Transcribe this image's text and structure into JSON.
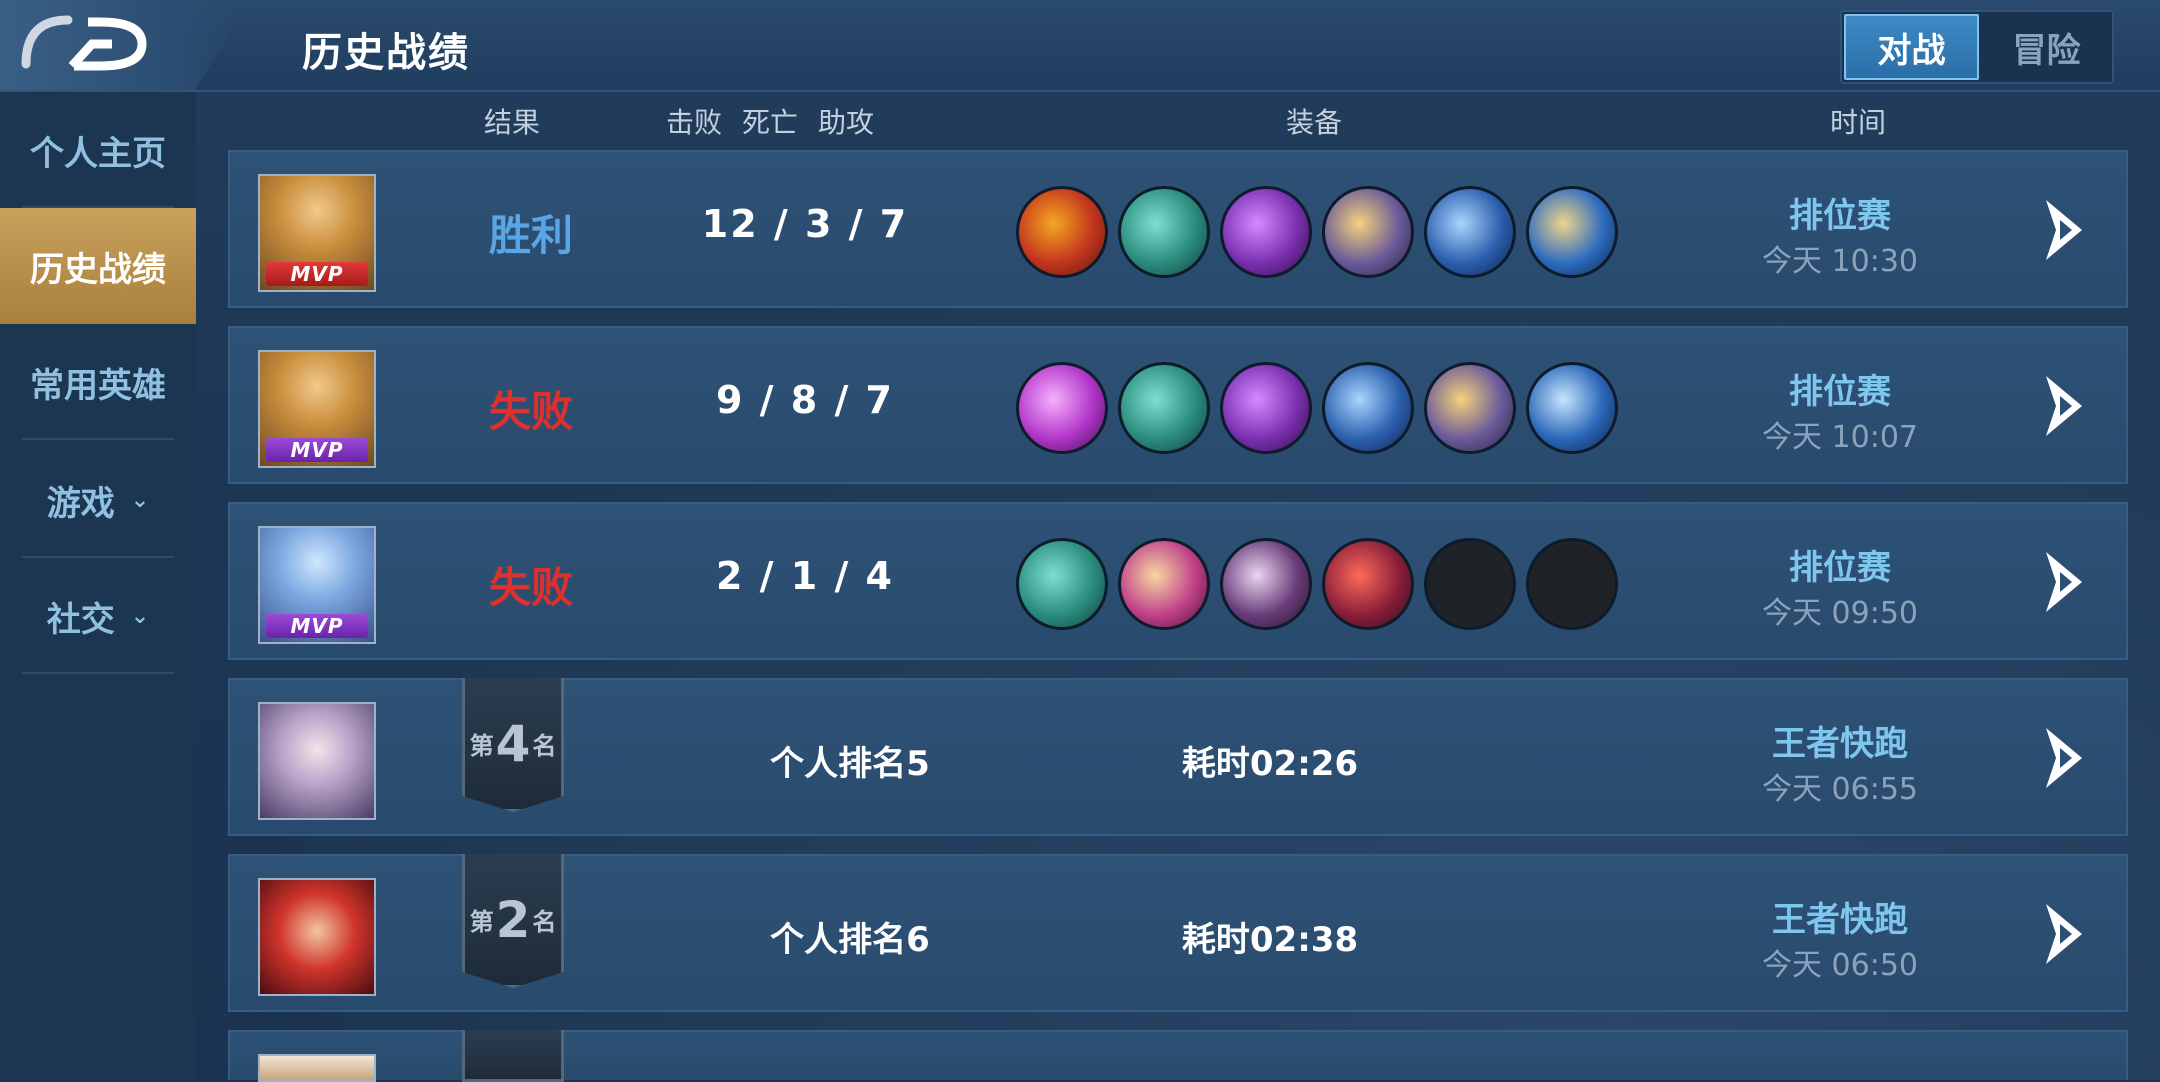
{
  "header": {
    "title": "历史战绩",
    "modes": [
      {
        "label": "对战",
        "active": true
      },
      {
        "label": "冒险",
        "active": false
      }
    ]
  },
  "sidebar": {
    "items": [
      {
        "label": "个人主页"
      },
      {
        "label": "历史战绩"
      },
      {
        "label": "常用英雄"
      },
      {
        "label": "游戏"
      },
      {
        "label": "社交"
      }
    ]
  },
  "columns": {
    "result": "结果",
    "kills": "击败",
    "deaths": "死亡",
    "assists": "助攻",
    "equipment": "装备",
    "time": "时间"
  },
  "matches": [
    {
      "mvp": "MVP",
      "mvp_color": "#c22222",
      "result": "胜利",
      "kda": "12 / 3 / 7",
      "mode": "排位赛",
      "time": "今天 10:30"
    },
    {
      "mvp": "MVP",
      "mvp_color": "#7b30b8",
      "result": "失败",
      "kda": "9 / 8 / 7",
      "mode": "排位赛",
      "time": "今天 10:07"
    },
    {
      "mvp": "MVP",
      "mvp_color": "#7b30b8",
      "result": "失败",
      "kda": "2 / 1 / 4",
      "mode": "排位赛",
      "time": "今天 09:50"
    },
    {
      "rank_prefix": "第",
      "rank": "4",
      "rank_suffix": "名",
      "personal_rank": "个人排名5",
      "duration": "耗时02:26",
      "mode": "王者快跑",
      "time": "今天 06:55"
    },
    {
      "rank_prefix": "第",
      "rank": "2",
      "rank_suffix": "名",
      "personal_rank": "个人排名6",
      "duration": "耗时02:38",
      "mode": "王者快跑",
      "time": "今天 06:50"
    }
  ],
  "colors": {
    "win": "#5aa5e6",
    "lose": "#e0302e",
    "mode_text": "#7fc6ee",
    "sidebar_active": "#b88f49"
  }
}
